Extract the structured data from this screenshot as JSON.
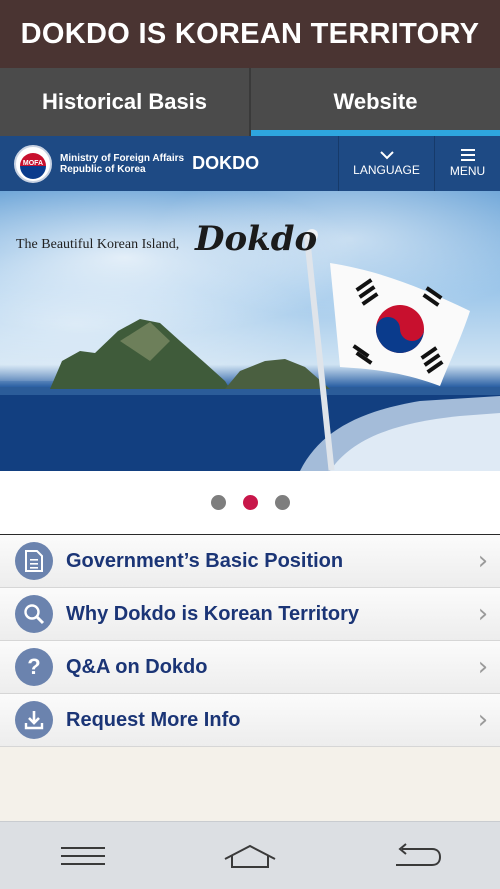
{
  "app": {
    "title": "DOKDO IS KOREAN TERRITORY"
  },
  "tabs": [
    {
      "label": "Historical Basis",
      "active": false
    },
    {
      "label": "Website",
      "active": true
    }
  ],
  "site_header": {
    "seal_text": "MOFA",
    "ministry_line1": "Ministry of Foreign Affairs",
    "ministry_line2": "Republic of Korea",
    "brand": "DOKDO",
    "language_label": "LANGUAGE",
    "menu_label": "MENU"
  },
  "hero": {
    "tagline": "The Beautiful Korean Island,",
    "script_title": "Dokdo"
  },
  "carousel": {
    "slides": 3,
    "active_index": 1
  },
  "menu_items": [
    {
      "label": "Government’s Basic Position",
      "icon": "document-icon"
    },
    {
      "label": "Why Dokdo is Korean Territory",
      "icon": "magnifier-icon"
    },
    {
      "label": "Q&A on Dokdo",
      "icon": "question-icon",
      "glyph": "?"
    },
    {
      "label": "Request More Info",
      "icon": "download-icon"
    }
  ],
  "colors": {
    "title_bar": "#4a3432",
    "tab_accent": "#2ea6df",
    "header_blue": "#1e4a84",
    "active_dot": "#c8174a",
    "menu_text": "#1b3576"
  }
}
